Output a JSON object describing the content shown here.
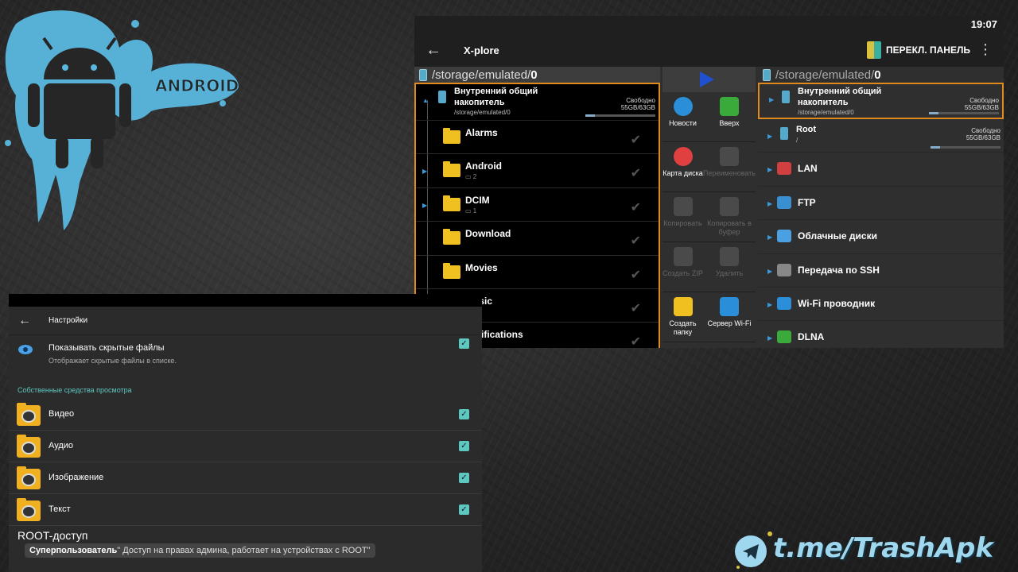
{
  "background": {
    "logo_text": "ANDROID",
    "telegram": "t.me/TrashApk"
  },
  "xplore": {
    "clock": "19:07",
    "title": "X-plore",
    "switch_panel": "ПЕРЕКЛ. ПАНЕЛЬ",
    "left_path_prefix": "/storage/emulated/",
    "left_path_last": "0",
    "right_path_prefix": "/storage/emulated/",
    "right_path_last": "0",
    "storage": {
      "name": "Внутренний общий накопитель",
      "path": "/storage/emulated/0",
      "free_label": "Свободно",
      "free_value": "55GB/63GB",
      "used_fraction": 0.14
    },
    "folders": [
      {
        "name": "Alarms",
        "sub": ""
      },
      {
        "name": "Android",
        "sub": "2"
      },
      {
        "name": "DCIM",
        "sub": "1"
      },
      {
        "name": "Download",
        "sub": ""
      },
      {
        "name": "Movies",
        "sub": ""
      },
      {
        "name": "Music",
        "sub": ""
      },
      {
        "name": "Notifications",
        "sub": ""
      }
    ],
    "tools": [
      {
        "label": "Новости",
        "icon": "info-icon",
        "color": "#2a8fd8",
        "enabled": true
      },
      {
        "label": "Вверх",
        "icon": "arrow-up-icon",
        "color": "#3aaa3a",
        "enabled": true
      },
      {
        "label": "Карта диска",
        "icon": "pie-chart-icon",
        "color": "#e04040",
        "enabled": true
      },
      {
        "label": "Переименовать",
        "icon": "rename-icon",
        "color": "#3060a0",
        "enabled": false
      },
      {
        "label": "Копировать",
        "icon": "copy-icon",
        "color": "#555555",
        "enabled": false
      },
      {
        "label": "Копировать в буфер",
        "icon": "clipboard-icon",
        "color": "#555555",
        "enabled": false
      },
      {
        "label": "Создать ZIP",
        "icon": "zip-icon",
        "color": "#555555",
        "enabled": false
      },
      {
        "label": "Удалить",
        "icon": "trash-icon",
        "color": "#a03030",
        "enabled": false
      },
      {
        "label": "Создать папку",
        "icon": "new-folder-icon",
        "color": "#f0c020",
        "enabled": true
      },
      {
        "label": "Сервер Wi-Fi",
        "icon": "wifi-icon",
        "color": "#2a8fd8",
        "enabled": true
      }
    ],
    "right_items": {
      "storage_name": "Внутренний общий накопитель",
      "storage_path": "/storage/emulated/0",
      "storage_free_label": "Свободно",
      "storage_free_value": "55GB/63GB",
      "root_name": "Root",
      "root_path": "/",
      "root_free_label": "Свободно",
      "root_free_value": "55GB/63GB",
      "entries": [
        {
          "name": "LAN",
          "icon": "lan-icon",
          "color": "#d04040"
        },
        {
          "name": "FTP",
          "icon": "ftp-icon",
          "color": "#3a8fd0"
        },
        {
          "name": "Облачные диски",
          "icon": "cloud-icon",
          "color": "#4aa0e0"
        },
        {
          "name": "Передача по SSH",
          "icon": "ssh-icon",
          "color": "#888888"
        },
        {
          "name": "Wi-Fi проводник",
          "icon": "wifi-icon",
          "color": "#2a8fd8"
        },
        {
          "name": "DLNA",
          "icon": "dlna-icon",
          "color": "#3aaa3a"
        }
      ]
    }
  },
  "settings": {
    "title": "Настройки",
    "hidden_files": {
      "title": "Показывать скрытые файлы",
      "sub": "Отображает скрытые файлы в списке."
    },
    "section": "Собственные средства просмотра",
    "viewers": [
      {
        "label": "Видео",
        "icon": "video-folder-icon"
      },
      {
        "label": "Аудио",
        "icon": "audio-folder-icon"
      },
      {
        "label": "Изображение",
        "icon": "image-folder-icon"
      },
      {
        "label": "Текст",
        "icon": "text-folder-icon"
      }
    ],
    "root_title": "ROOT-доступ",
    "tooltip_bold": "Суперпользователь",
    "tooltip_rest": "\" Доступ на правах админа, работает на устройствах с ROOT\""
  }
}
